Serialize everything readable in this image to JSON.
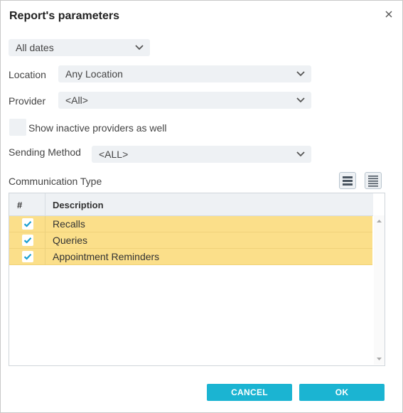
{
  "dialog": {
    "title": "Report's parameters",
    "close_icon": "close-icon"
  },
  "dates": {
    "value": "All dates"
  },
  "location": {
    "label": "Location",
    "value": "Any Location"
  },
  "provider": {
    "label": "Provider",
    "value": "<All>"
  },
  "inactive": {
    "label": "Show inactive providers as well",
    "checked": false
  },
  "sending": {
    "label": "Sending Method",
    "value": "<ALL>"
  },
  "communication": {
    "label": "Communication Type",
    "view_buttons": [
      "list-view-icon",
      "compact-list-view-icon"
    ],
    "columns": [
      "#",
      "Description"
    ],
    "rows": [
      {
        "checked": true,
        "description": "Recalls"
      },
      {
        "checked": true,
        "description": "Queries"
      },
      {
        "checked": true,
        "description": "Appointment Reminders"
      }
    ]
  },
  "footer": {
    "cancel_label": "CANCEL",
    "ok_label": "OK"
  },
  "colors": {
    "accent": "#1bb4d2",
    "selected_row": "#fbdf8a",
    "field_bg": "#eef1f4"
  }
}
